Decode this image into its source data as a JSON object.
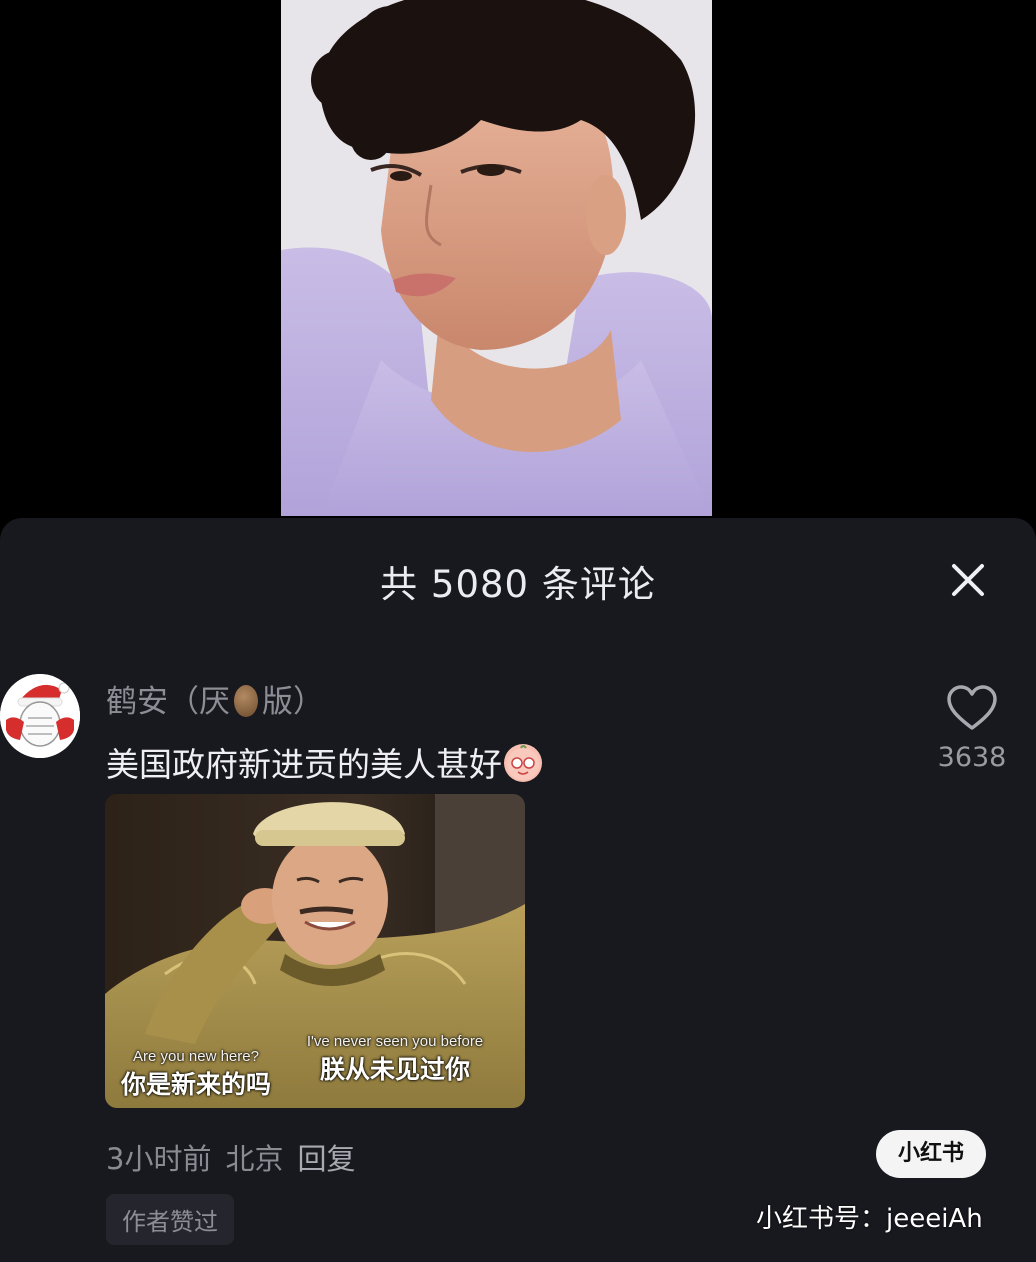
{
  "sheet": {
    "title": "共 5080 条评论",
    "close_icon": "close-icon"
  },
  "comment": {
    "username_left": "鹤安（厌",
    "username_right": "版）",
    "text": "美国政府新进贡的美人甚好",
    "like_count": "3638",
    "time": "3小时前",
    "location": "北京",
    "reply_label": "回复",
    "author_badge": "作者赞过",
    "meme": {
      "caption_left_en": "Are you new here?",
      "caption_left_cn": "你是新来的吗",
      "caption_right_en": "I've never seen you before",
      "caption_right_cn": "朕从未见过你"
    }
  },
  "brand": {
    "pill_label": "小红书",
    "watermark": "小红书号：jeeeiAh"
  },
  "colors": {
    "sheet_bg": "#18181f",
    "primary_text": "#efeff3",
    "secondary_text": "#8d8d95"
  }
}
